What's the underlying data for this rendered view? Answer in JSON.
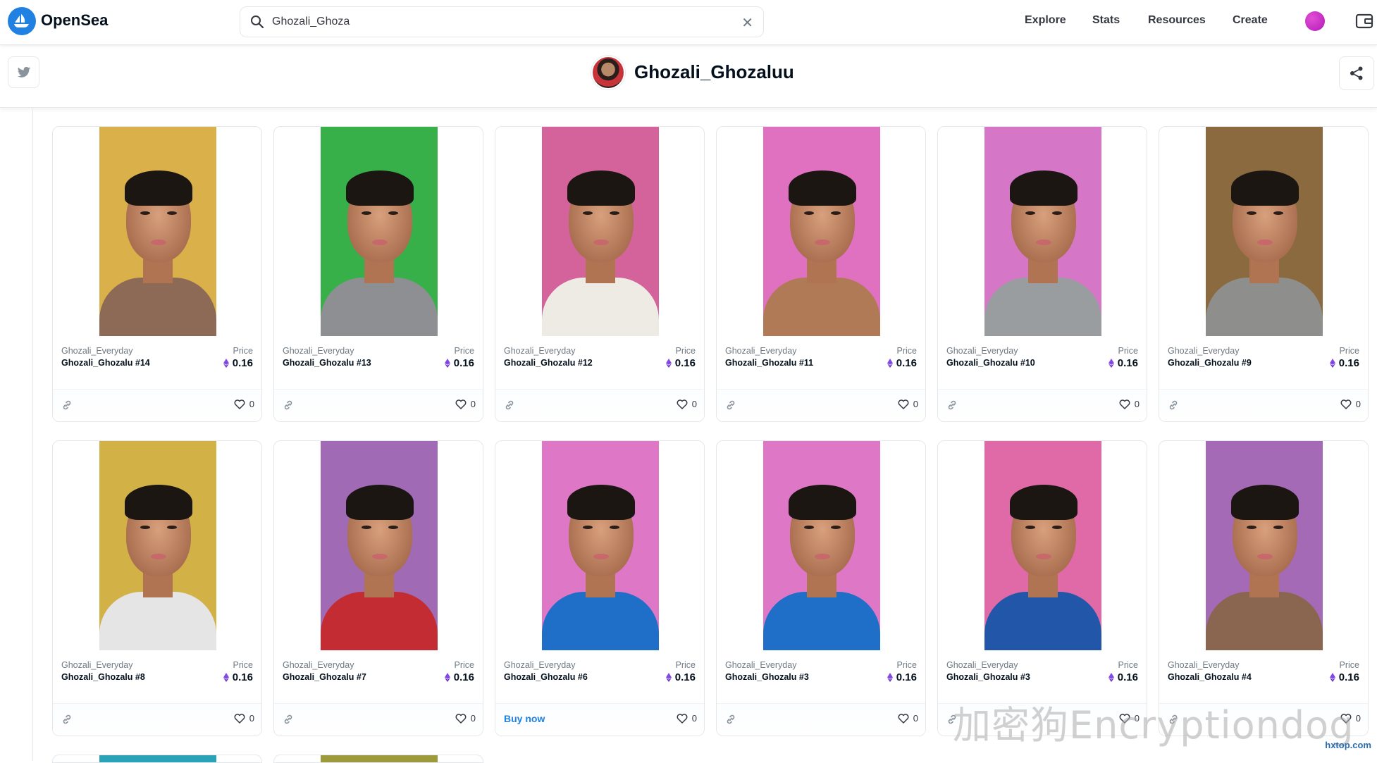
{
  "nav": {
    "brand": "OpenSea",
    "search_value": "Ghozali_Ghoza",
    "links": [
      "Explore",
      "Stats",
      "Resources",
      "Create"
    ],
    "accent_color": "#2081e2"
  },
  "profile": {
    "name": "Ghozali_Ghozaluu"
  },
  "cards": [
    {
      "collection": "Ghozali_Everyday",
      "name": "Ghozali_Ghozalu #14",
      "price_label": "Price",
      "price": "0.16",
      "likes": "0",
      "bg": "#d9b04a",
      "shirt": "#8d6a55",
      "footer": "link"
    },
    {
      "collection": "Ghozali_Everyday",
      "name": "Ghozali_Ghozalu #13",
      "price_label": "Price",
      "price": "0.16",
      "likes": "0",
      "bg": "#38b04a",
      "shirt": "#8d8f93",
      "footer": "link"
    },
    {
      "collection": "Ghozali_Everyday",
      "name": "Ghozali_Ghozalu #12",
      "price_label": "Price",
      "price": "0.16",
      "likes": "0",
      "bg": "#d4639b",
      "shirt": "#eeeae4",
      "footer": "link"
    },
    {
      "collection": "Ghozali_Everyday",
      "name": "Ghozali_Ghozalu #11",
      "price_label": "Price",
      "price": "0.16",
      "likes": "0",
      "bg": "#e070c0",
      "shirt": "#b07a57",
      "footer": "link"
    },
    {
      "collection": "Ghozali_Everyday",
      "name": "Ghozali_Ghozalu #10",
      "price_label": "Price",
      "price": "0.16",
      "likes": "0",
      "bg": "#d676c6",
      "shirt": "#9a9d9f",
      "footer": "link"
    },
    {
      "collection": "Ghozali_Everyday",
      "name": "Ghozali_Ghozalu #9",
      "price_label": "Price",
      "price": "0.16",
      "likes": "0",
      "bg": "#8a6a3e",
      "shirt": "#8e8f8d",
      "footer": "link"
    },
    {
      "collection": "Ghozali_Everyday",
      "name": "Ghozali_Ghozalu #8",
      "price_label": "Price",
      "price": "0.16",
      "likes": "0",
      "bg": "#d2b246",
      "shirt": "#e5e5e5",
      "footer": "link"
    },
    {
      "collection": "Ghozali_Everyday",
      "name": "Ghozali_Ghozalu #7",
      "price_label": "Price",
      "price": "0.16",
      "likes": "0",
      "bg": "#a06ab4",
      "shirt": "#c42c34",
      "footer": "link"
    },
    {
      "collection": "Ghozali_Everyday",
      "name": "Ghozali_Ghozalu #6",
      "price_label": "Price",
      "price": "0.16",
      "likes": "0",
      "bg": "#de78c6",
      "shirt": "#1f6ec7",
      "footer": "buy",
      "buy_label": "Buy now"
    },
    {
      "collection": "Ghozali_Everyday",
      "name": "Ghozali_Ghozalu #3",
      "price_label": "Price",
      "price": "0.16",
      "likes": "0",
      "bg": "#de78c6",
      "shirt": "#1f6ec7",
      "footer": "link"
    },
    {
      "collection": "Ghozali_Everyday",
      "name": "Ghozali_Ghozalu #3",
      "price_label": "Price",
      "price": "0.16",
      "likes": "0",
      "bg": "#e06aa8",
      "shirt": "#2156a8",
      "footer": "link"
    },
    {
      "collection": "Ghozali_Everyday",
      "name": "Ghozali_Ghozalu #4",
      "price_label": "Price",
      "price": "0.16",
      "likes": "0",
      "bg": "#a46ab6",
      "shirt": "#8a6650",
      "footer": "link"
    }
  ],
  "watermark": {
    "text": "加密狗Encryptiondog",
    "site": "hxtop.com"
  }
}
